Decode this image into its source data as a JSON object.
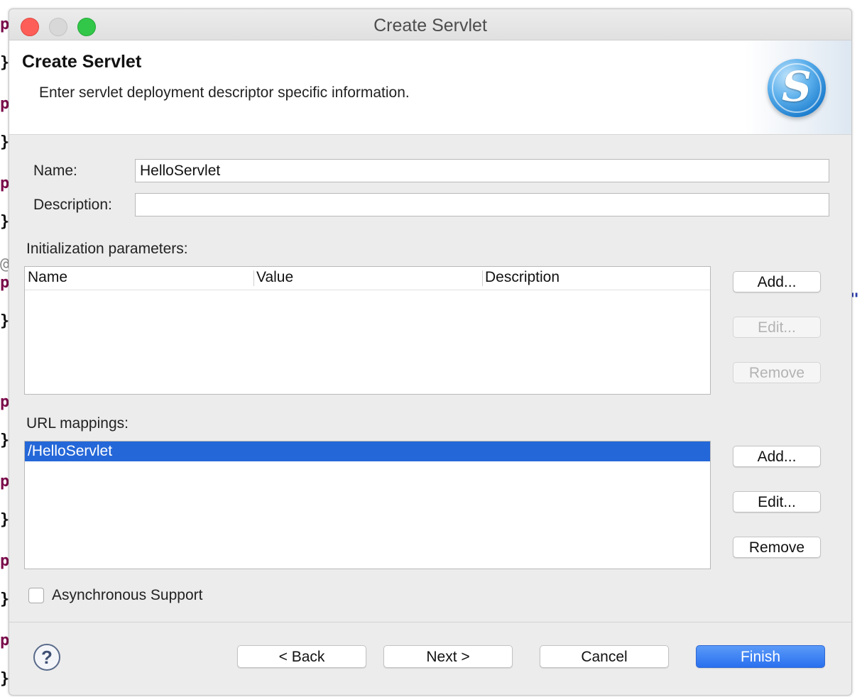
{
  "window": {
    "title": "Create Servlet"
  },
  "banner": {
    "title": "Create Servlet",
    "description": "Enter servlet deployment descriptor specific information.",
    "logo_letter": "S"
  },
  "form": {
    "name_label": "Name:",
    "name_value": "HelloServlet",
    "description_label": "Description:",
    "description_value": ""
  },
  "init_params": {
    "label": "Initialization parameters:",
    "columns": [
      "Name",
      "Value",
      "Description"
    ],
    "rows": [],
    "add_label": "Add...",
    "edit_label": "Edit...",
    "remove_label": "Remove"
  },
  "url_mappings": {
    "label": "URL mappings:",
    "rows": [
      "/HelloServlet"
    ],
    "add_label": "Add...",
    "edit_label": "Edit...",
    "remove_label": "Remove"
  },
  "async": {
    "label": "Asynchronous Support",
    "checked": false
  },
  "footer": {
    "help_glyph": "?",
    "back_label": "< Back",
    "next_label": "Next >",
    "cancel_label": "Cancel",
    "finish_label": "Finish"
  },
  "background_glyphs": {
    "p": "p",
    "brace": "}",
    "at": "@",
    "quote": "\""
  },
  "colors": {
    "accent": "#2467d8",
    "primary_button": "#2a70ef",
    "close": "#fd5e57",
    "maximize": "#32c748"
  }
}
